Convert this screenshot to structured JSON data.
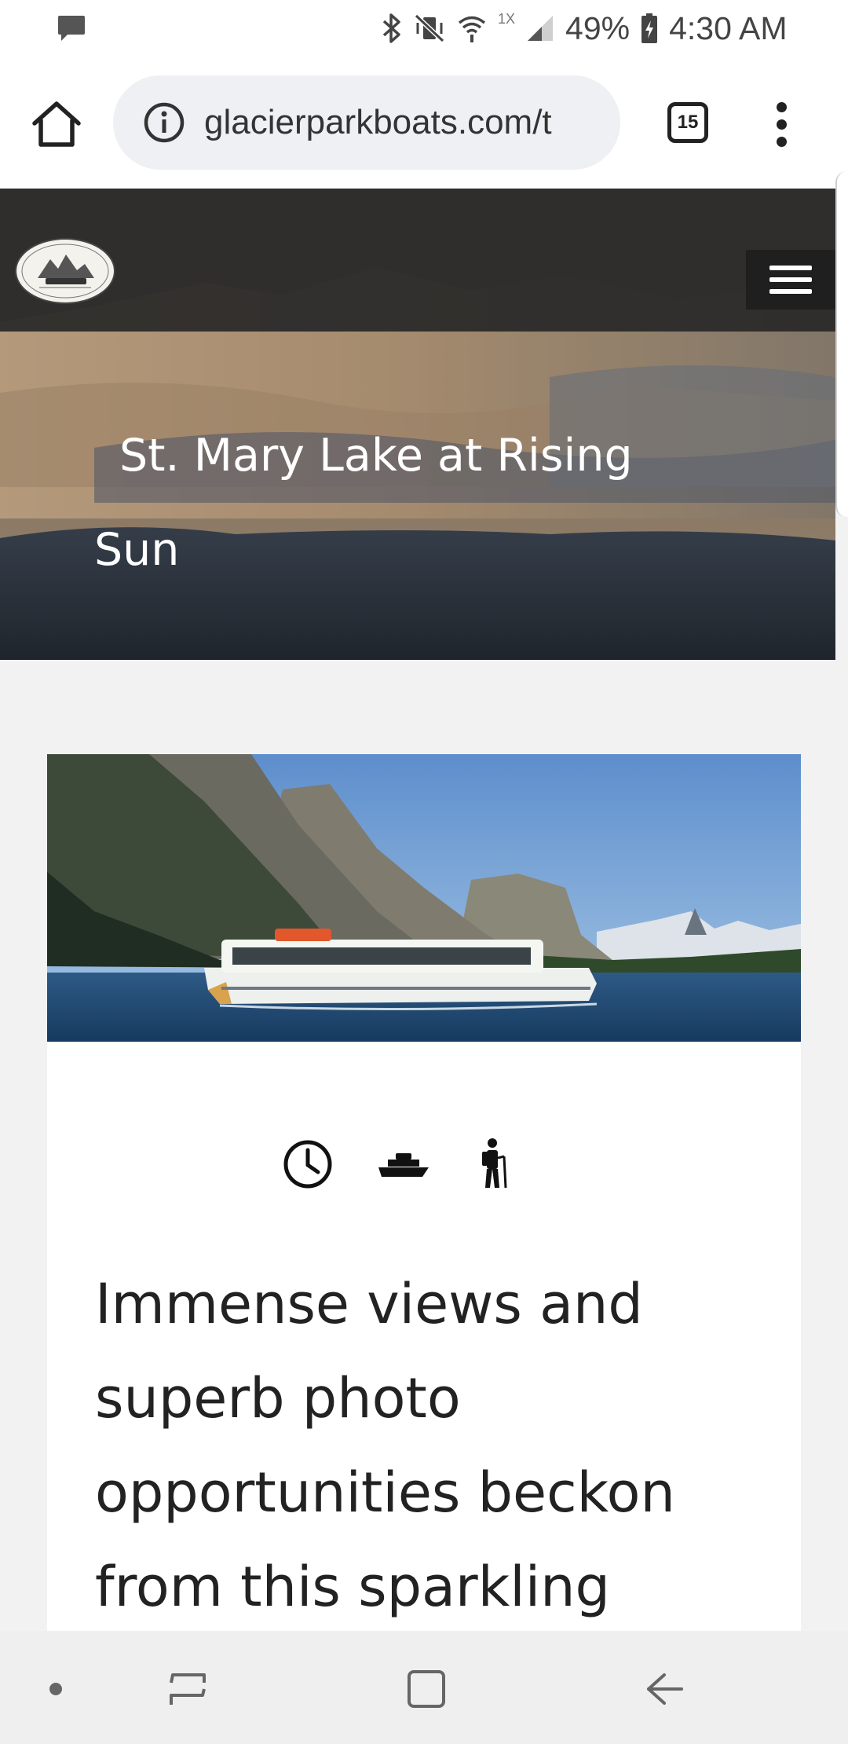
{
  "status_bar": {
    "icons": [
      "message-icon",
      "bluetooth-icon",
      "vibrate-mute-icon",
      "wifi-icon",
      "signal-icon",
      "battery-icon"
    ],
    "network_label": "1X",
    "battery": "49%",
    "time": "4:30 AM"
  },
  "browser": {
    "url": "glacierparkboats.com/t",
    "tab_count": "15",
    "icons": [
      "home-icon",
      "info-icon",
      "more-vert-icon"
    ]
  },
  "hero": {
    "title": "St. Mary Lake at Rising Sun"
  },
  "card": {
    "feature_icons": [
      "clock-icon",
      "boat-icon",
      "hiker-icon"
    ],
    "description": "Immense views and superb photo opportunities beckon from this sparkling"
  },
  "nav_bar": {
    "icons": [
      "dot-icon",
      "recent-apps-icon",
      "home-square-icon",
      "back-icon"
    ]
  }
}
